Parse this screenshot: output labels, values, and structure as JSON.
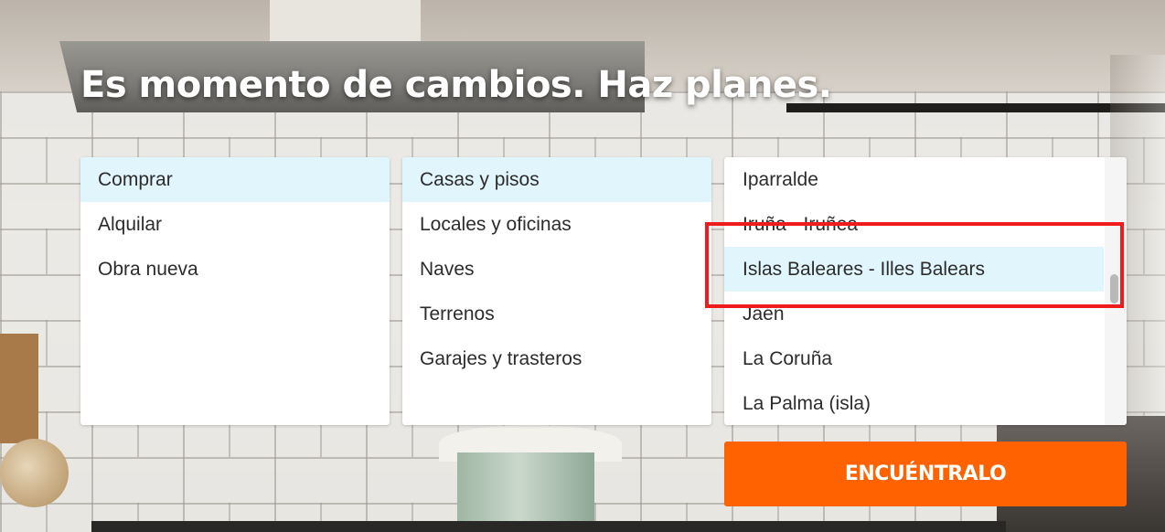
{
  "hero": {
    "headline": "Es momento de cambios. Haz planes."
  },
  "operation_list": {
    "items": [
      {
        "label": "Comprar",
        "selected": true
      },
      {
        "label": "Alquilar",
        "selected": false
      },
      {
        "label": "Obra nueva",
        "selected": false
      }
    ]
  },
  "property_type_list": {
    "items": [
      {
        "label": "Casas y pisos",
        "selected": true
      },
      {
        "label": "Locales y oficinas",
        "selected": false
      },
      {
        "label": "Naves",
        "selected": false
      },
      {
        "label": "Terrenos",
        "selected": false
      },
      {
        "label": "Garajes y trasteros",
        "selected": false
      }
    ]
  },
  "location_list": {
    "items": [
      {
        "label": "Iparralde",
        "selected": false
      },
      {
        "label": "Iruña - Iruñea",
        "selected": false
      },
      {
        "label": "Islas Baleares - Illes Balears",
        "selected": true
      },
      {
        "label": "Jaén",
        "selected": false
      },
      {
        "label": "La Coruña",
        "selected": false
      },
      {
        "label": "La Palma (isla)",
        "selected": false
      }
    ]
  },
  "search_button": {
    "label": "ENCUÉNTRALO"
  },
  "colors": {
    "accent": "#ff6200",
    "selected_row": "#e1f5fd",
    "annotation_box": "#ee1c1c"
  }
}
